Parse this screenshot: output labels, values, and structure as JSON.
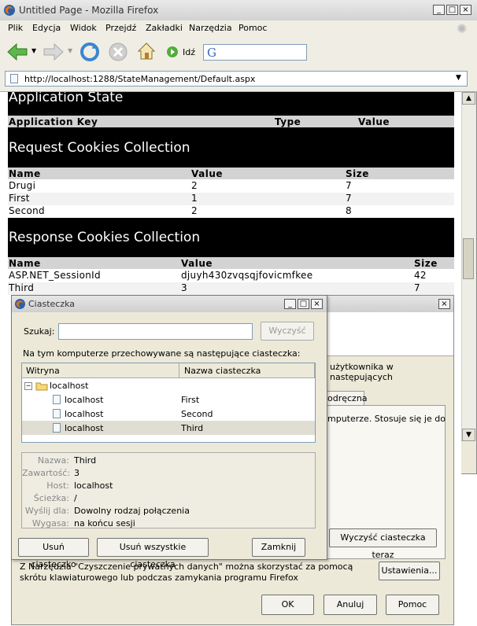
{
  "browser": {
    "title": "Untitled Page - Mozilla Firefox",
    "menus": [
      "Plik",
      "Edycja",
      "Widok",
      "Przejdź",
      "Zakładki",
      "Narzędzia",
      "Pomoc"
    ],
    "go_label": "Idź",
    "address": "http://localhost:1288/StateManagement/Default.aspx"
  },
  "page": {
    "app_state": {
      "title": "Application State",
      "headers": [
        "Application Key",
        "Type",
        "Value"
      ]
    },
    "request_cookies": {
      "title": "Request Cookies Collection",
      "headers": [
        "Name",
        "Value",
        "Size"
      ],
      "rows": [
        [
          "Drugi",
          "2",
          "7"
        ],
        [
          "First",
          "1",
          "7"
        ],
        [
          "Second",
          "2",
          "8"
        ]
      ]
    },
    "response_cookies": {
      "title": "Response Cookies Collection",
      "headers": [
        "Name",
        "Value",
        "Size"
      ],
      "rows": [
        [
          "ASP.NET_SessionId",
          "djuyh430zvqsqjfovicmfkee",
          "42"
        ],
        [
          "Third",
          "3",
          "7"
        ]
      ]
    }
  },
  "prefs_dialog": {
    "text1": "użytkownika w następujących",
    "tab_label": "odręczna",
    "text2": "mputerze. Stosuje się je do",
    "clear_cookies_now": "Wyczyść ciasteczka teraz",
    "bottom_text": "Z Narzędzia \"Czyszczenie prywatnych danych\" można skorzystać za pomocą skrótu klawiaturowego lub podczas zamykania programu Firefox",
    "settings": "Ustawienia...",
    "ok": "OK",
    "cancel": "Anuluj",
    "help": "Pomoc"
  },
  "cookies_dialog": {
    "title": "Ciasteczka",
    "search_label": "Szukaj:",
    "search_value": "",
    "clear_search": "Wyczyść",
    "info_text": "Na tym komputerze przechowywane są następujące ciasteczka:",
    "col_site": "Witryna",
    "col_name": "Nazwa ciasteczka",
    "tree_root": "localhost",
    "items": [
      {
        "site": "localhost",
        "name": "First"
      },
      {
        "site": "localhost",
        "name": "Second"
      },
      {
        "site": "localhost",
        "name": "Third"
      }
    ],
    "details": [
      {
        "label": "Nazwa:",
        "value": "Third"
      },
      {
        "label": "Zawartość:",
        "value": "3"
      },
      {
        "label": "Host:",
        "value": "localhost"
      },
      {
        "label": "Ścieżka:",
        "value": "/"
      },
      {
        "label": "Wyślij dla:",
        "value": "Dowolny rodzaj połączenia"
      },
      {
        "label": "Wygasa:",
        "value": "na końcu sesji"
      }
    ],
    "remove": "Usuń ciasteczko",
    "remove_all": "Usuń wszystkie ciasteczka",
    "close": "Zamknij"
  },
  "colors": {
    "header_bg": "#000000",
    "table_header_bg": "#d3d3d3",
    "selected_row": "#e0ddd2"
  }
}
